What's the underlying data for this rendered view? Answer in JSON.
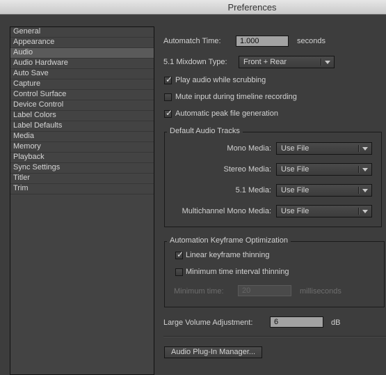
{
  "window": {
    "title": "Preferences"
  },
  "sidebar": {
    "selected": "Audio",
    "items": [
      {
        "label": "General"
      },
      {
        "label": "Appearance"
      },
      {
        "label": "Audio"
      },
      {
        "label": "Audio Hardware"
      },
      {
        "label": "Auto Save"
      },
      {
        "label": "Capture"
      },
      {
        "label": "Control Surface"
      },
      {
        "label": "Device Control"
      },
      {
        "label": "Label Colors"
      },
      {
        "label": "Label Defaults"
      },
      {
        "label": "Media"
      },
      {
        "label": "Memory"
      },
      {
        "label": "Playback"
      },
      {
        "label": "Sync Settings"
      },
      {
        "label": "Titler"
      },
      {
        "label": "Trim"
      }
    ]
  },
  "audio": {
    "automatch_label": "Automatch Time:",
    "automatch_value": "1.000",
    "automatch_unit": "seconds",
    "mixdown_label": "5.1 Mixdown Type:",
    "mixdown_value": "Front + Rear",
    "checkboxes": [
      {
        "label": "Play audio while scrubbing",
        "checked": true
      },
      {
        "label": "Mute input during timeline recording",
        "checked": false
      },
      {
        "label": "Automatic peak file generation",
        "checked": true
      }
    ],
    "default_tracks": {
      "title": "Default Audio Tracks",
      "rows": [
        {
          "label": "Mono Media:",
          "value": "Use File"
        },
        {
          "label": "Stereo Media:",
          "value": "Use File"
        },
        {
          "label": "5.1 Media:",
          "value": "Use File"
        },
        {
          "label": "Multichannel Mono Media:",
          "value": "Use File"
        }
      ]
    },
    "keyframe_opt": {
      "title": "Automation Keyframe Optimization",
      "checkboxes": [
        {
          "label": "Linear keyframe thinning",
          "checked": true
        },
        {
          "label": "Minimum time interval thinning",
          "checked": false
        }
      ],
      "min_time_label": "Minimum time:",
      "min_time_value": "20",
      "min_time_unit": "milliseconds"
    },
    "large_volume_label": "Large Volume Adjustment:",
    "large_volume_value": "6",
    "large_volume_unit": "dB",
    "plugin_manager_button": "Audio Plug-In Manager..."
  },
  "icons": {
    "check": "✓"
  }
}
